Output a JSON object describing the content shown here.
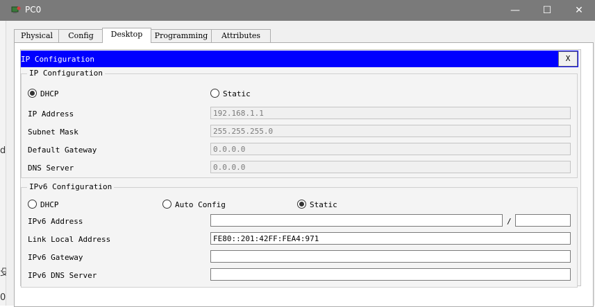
{
  "window": {
    "title": "PC0",
    "minimize": "—",
    "maximize": "☐",
    "close": "✕"
  },
  "left_strip": [
    "d",
    "殳",
    "0"
  ],
  "tabs": [
    {
      "label": "Physical"
    },
    {
      "label": "Config"
    },
    {
      "label": "Desktop",
      "active": true
    },
    {
      "label": "Programming"
    },
    {
      "label": "Attributes"
    }
  ],
  "panel": {
    "title": "IP Configuration",
    "close_label": "X"
  },
  "ipv4": {
    "group_title": "IP Configuration",
    "dhcp_label": "DHCP",
    "static_label": "Static",
    "selected": "DHCP",
    "ip_address_label": "IP Address",
    "ip_address": "192.168.1.1",
    "subnet_mask_label": "Subnet Mask",
    "subnet_mask": "255.255.255.0",
    "gateway_label": "Default Gateway",
    "gateway": "0.0.0.0",
    "dns_label": "DNS Server",
    "dns": "0.0.0.0"
  },
  "ipv6": {
    "group_title": "IPv6 Configuration",
    "dhcp_label": "DHCP",
    "auto_label": "Auto Config",
    "static_label": "Static",
    "selected": "Static",
    "address_label": "IPv6 Address",
    "address": "",
    "prefix_separator": "/",
    "prefix": "",
    "link_local_label": "Link Local Address",
    "link_local": "FE80::201:42FF:FEA4:971",
    "gateway_label": "IPv6 Gateway",
    "gateway": "",
    "dns_label": "IPv6 DNS Server",
    "dns": ""
  },
  "colors": {
    "titlebar": "#7a7a7a",
    "panel_bar": "#0000ff"
  }
}
